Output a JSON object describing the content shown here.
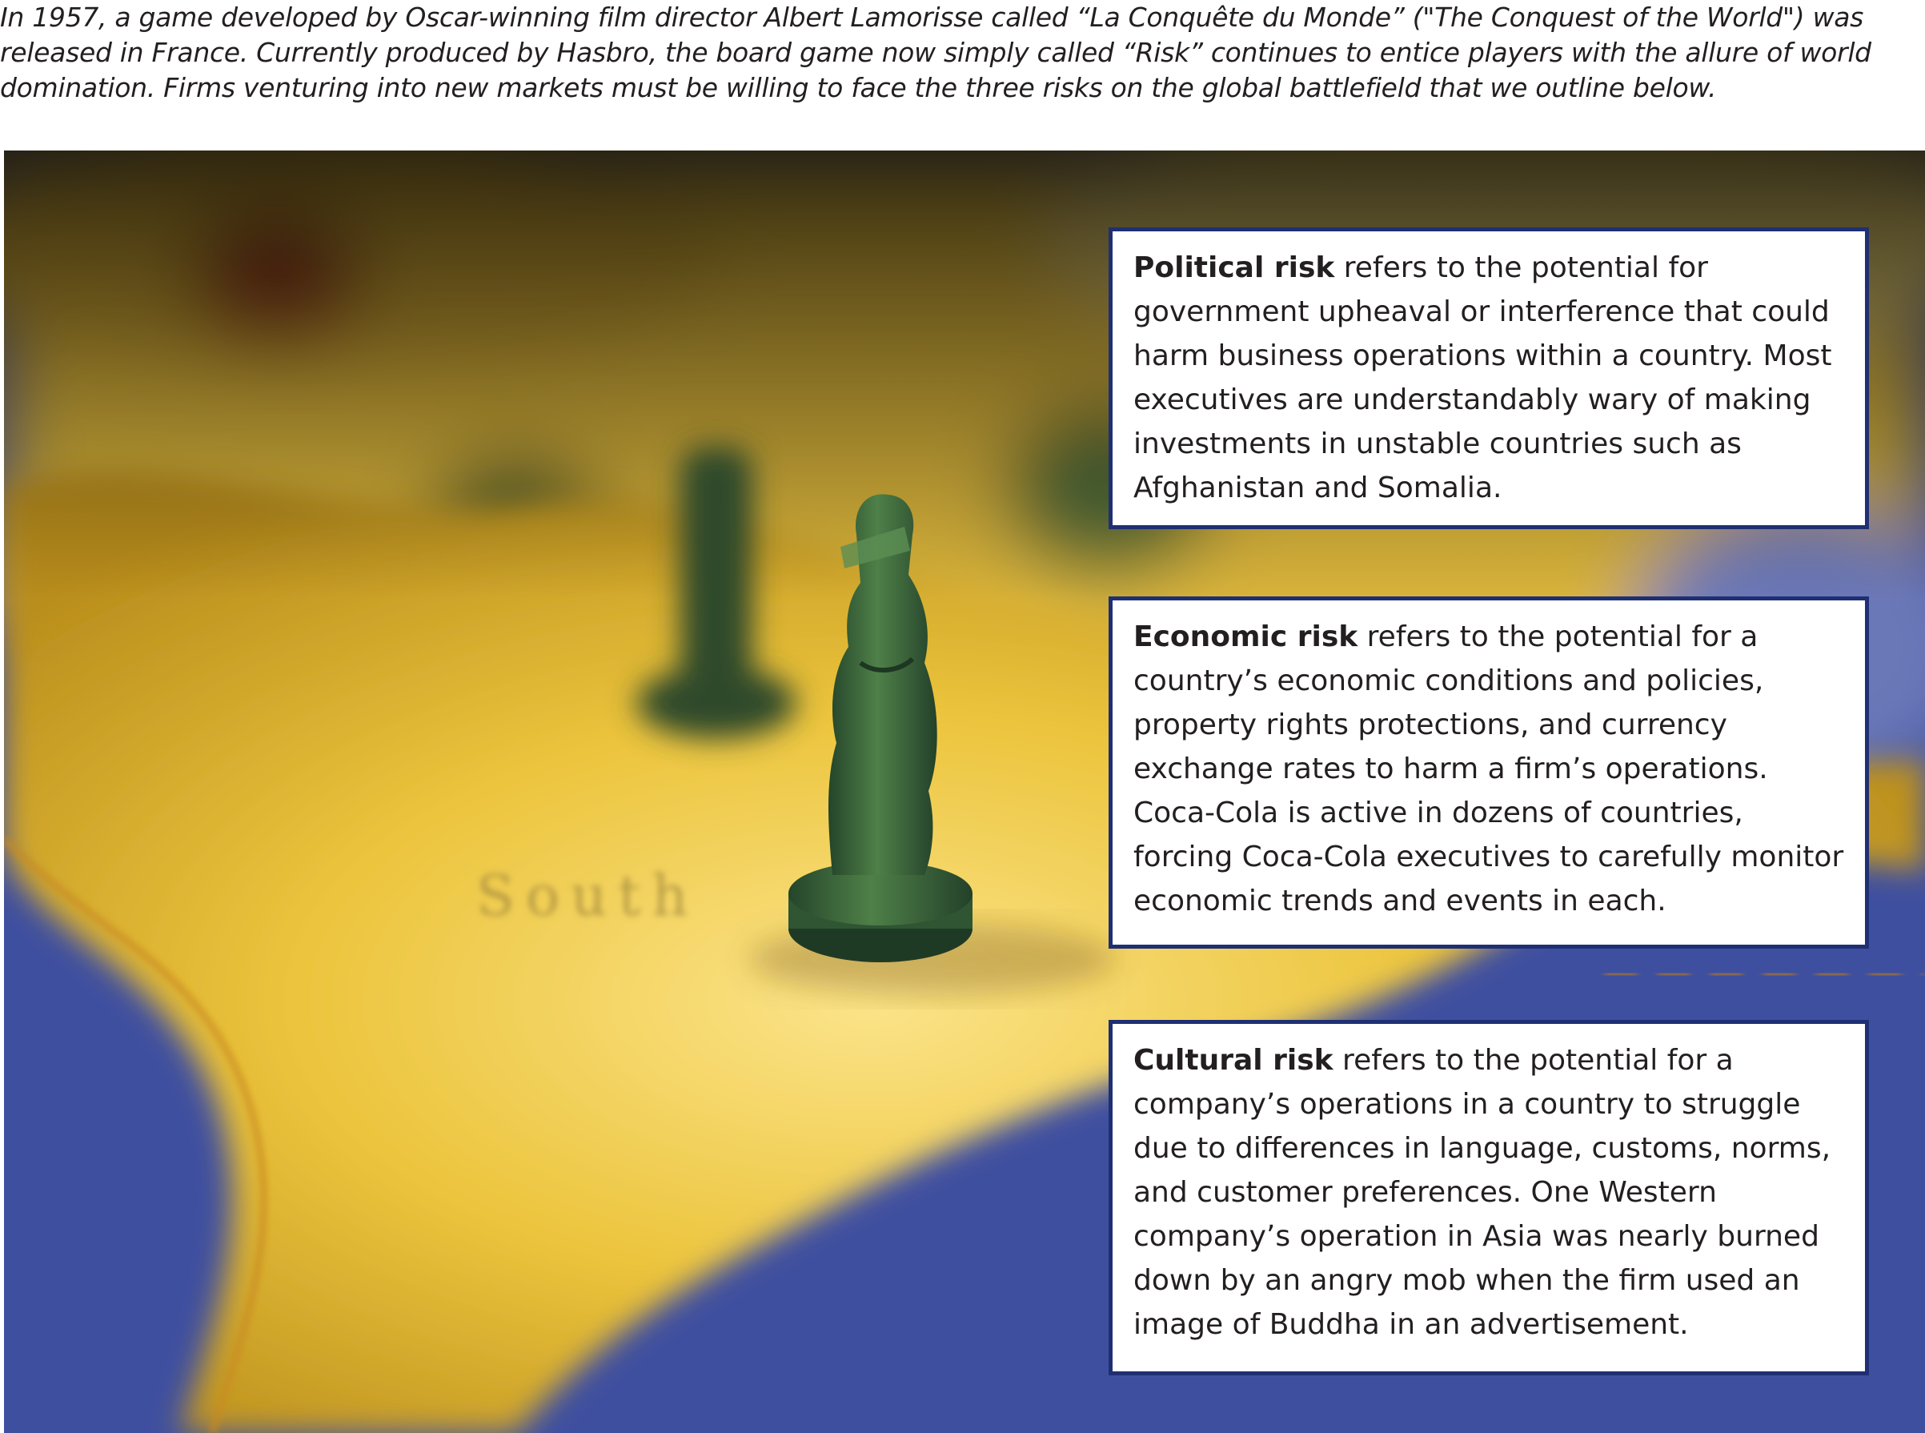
{
  "intro": "In 1957, a game developed by Oscar-winning film director Albert Lamorisse called “La Conquête du Monde” (\"The Conquest of the World\") was released in France. Currently produced by Hasbro, the board game now simply called “Risk” continues to entice players with the allure of world domination. Firms venturing into new markets must be willing to face the three risks on the global battlefield that we outline below.",
  "risks": [
    {
      "term": "Political risk",
      "text": " refers to the potential for government upheaval or interference that could harm business operations within a country. Most executives are understandably wary of making investments in unstable countries such as Afghanistan and Somalia."
    },
    {
      "term": "Economic risk",
      "text": " refers to the potential for a country’s economic conditions and policies, property rights protections, and currency exchange rates to harm a firm’s operations. Coca-Cola is active in dozens of countries, forcing Coca-Cola executives to carefully monitor economic trends and events in each."
    },
    {
      "term": "Cultural risk",
      "text": " refers to the potential for a company’s operations in a country to struggle due to differences in language, customs, norms, and customer preferences. One Western company’s operation in Asia was nearly burned down by an angry mob when the firm used an image of Buddha in an advertisement."
    }
  ],
  "photo": {
    "map_label": "South"
  },
  "colors": {
    "card_border": "#1f2f73",
    "ocean": "#3f4fa0",
    "land": "#e8c23a",
    "game_piece": "#3f6b3a"
  }
}
